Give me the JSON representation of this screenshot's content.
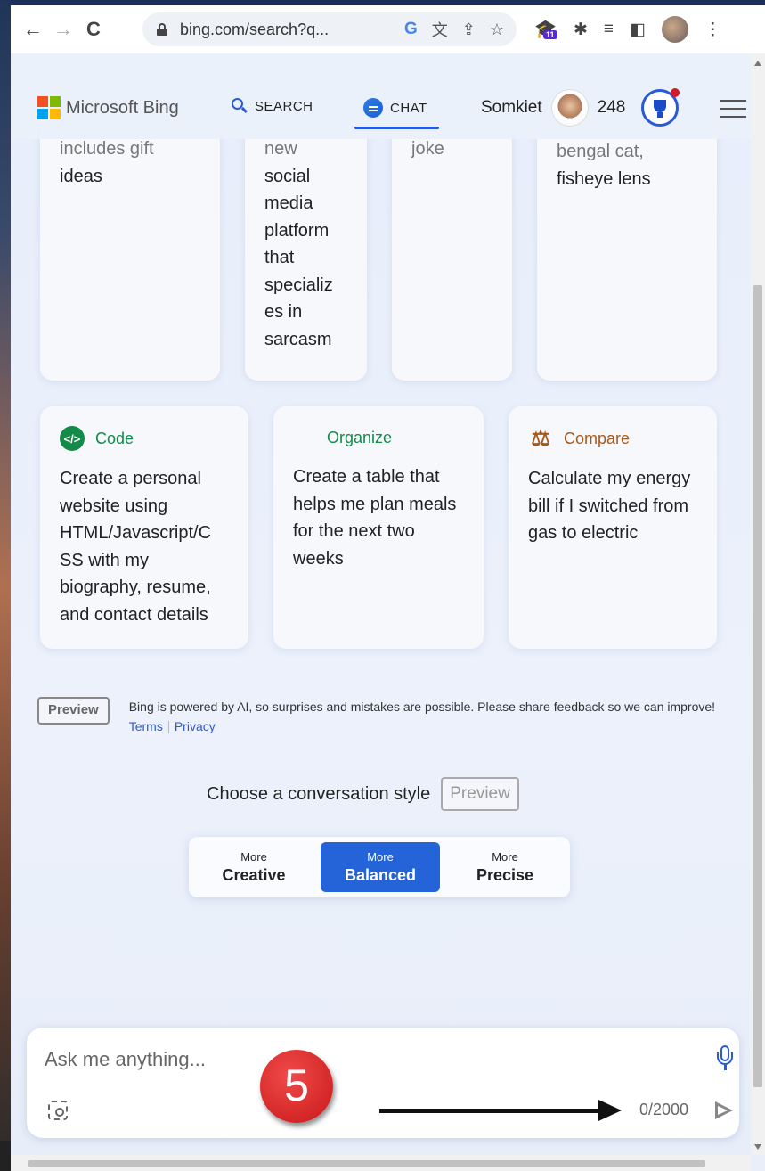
{
  "browser": {
    "url": "bing.com/search?q...",
    "back_glyph": "←",
    "forward_glyph": "→",
    "reload_glyph": "C",
    "google_letter": "G",
    "extension_badge": "11"
  },
  "header": {
    "logo_text": "Microsoft Bing",
    "tabs": [
      {
        "label": "SEARCH",
        "icon": "search-icon"
      },
      {
        "label": "CHAT",
        "icon": "chat-icon",
        "active": true
      }
    ],
    "user_name": "Somkiet",
    "points": "248"
  },
  "top_cards": [
    {
      "faded": "includes gift",
      "text": "ideas"
    },
    {
      "faded": "new",
      "text": "social media platform that specializ es in sarcasm"
    },
    {
      "faded": "joke",
      "text": ""
    },
    {
      "faded": "bengal cat,",
      "text": "fisheye lens"
    }
  ],
  "cards": [
    {
      "label": "Code",
      "icon": "code-icon",
      "text": "Create a personal website using HTML/Javascript/C SS with my biography, resume, and contact details"
    },
    {
      "label": "Organize",
      "icon": "grid-icon",
      "text": "Create a table that helps me plan meals for the next two weeks"
    },
    {
      "label": "Compare",
      "icon": "scale-icon",
      "text": "Calculate my energy bill if I switched from gas to electric"
    }
  ],
  "disclaimer": {
    "tag": "Preview",
    "text": "Bing is powered by AI, so surprises and mistakes are possible. Please share feedback so we can improve!",
    "terms": "Terms",
    "privacy": "Privacy"
  },
  "conversation": {
    "label": "Choose a conversation style",
    "preview_tag": "Preview",
    "options": [
      {
        "small": "More",
        "big": "Creative"
      },
      {
        "small": "More",
        "big": "Balanced",
        "active": true
      },
      {
        "small": "More",
        "big": "Precise"
      }
    ]
  },
  "input": {
    "placeholder": "Ask me anything...",
    "counter": "0/2000"
  },
  "annotation": {
    "step_number": "5"
  },
  "colors": {
    "accent": "#2563d9",
    "code_green": "#138a47",
    "compare_orange": "#a8581a",
    "step_badge": "#d42020"
  }
}
